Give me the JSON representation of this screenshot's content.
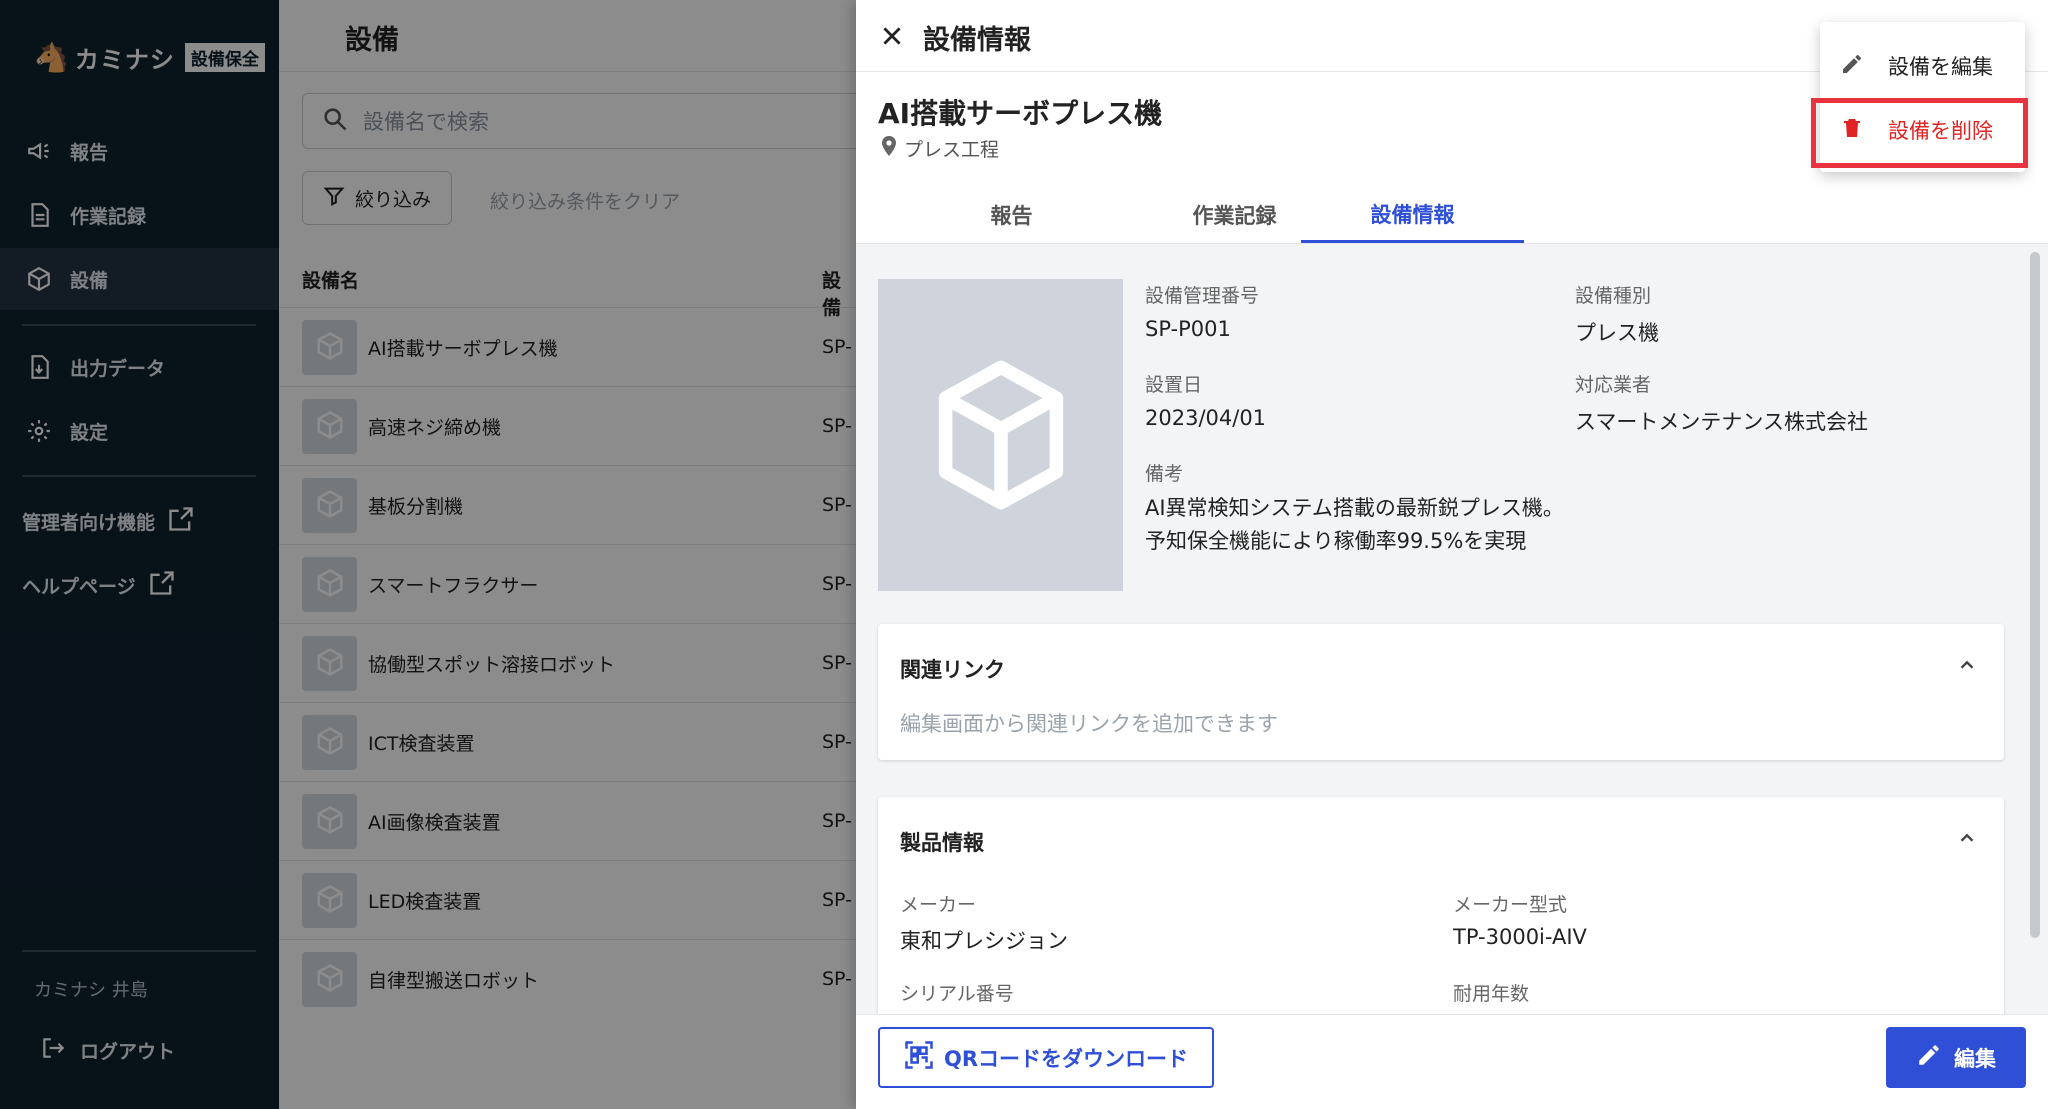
{
  "sidebar": {
    "logo_text": "カミナシ",
    "logo_badge": "設備保全",
    "items": [
      {
        "label": "報告",
        "icon": "megaphone-icon"
      },
      {
        "label": "作業記録",
        "icon": "document-icon"
      },
      {
        "label": "設備",
        "icon": "cube-icon"
      },
      {
        "label": "出力データ",
        "icon": "file-export-icon"
      },
      {
        "label": "設定",
        "icon": "gear-icon"
      }
    ],
    "external": [
      {
        "label": "管理者向け機能",
        "icon": "external-link-icon"
      },
      {
        "label": "ヘルプページ",
        "icon": "external-link-icon"
      }
    ],
    "user_name": "カミナシ 井島",
    "logout_label": "ログアウト"
  },
  "main": {
    "title": "設備",
    "search_placeholder": "設備名で検索",
    "filter_label": "絞り込み",
    "clear_filter_label": "絞り込み条件をクリア",
    "columns": [
      "設備名",
      "設備"
    ],
    "rows": [
      {
        "name": "AI搭載サーボプレス機",
        "code": "SP-"
      },
      {
        "name": "高速ネジ締め機",
        "code": "SP-"
      },
      {
        "name": "基板分割機",
        "code": "SP-"
      },
      {
        "name": "スマートフラクサー",
        "code": "SP-"
      },
      {
        "name": "協働型スポット溶接ロボット",
        "code": "SP-"
      },
      {
        "name": "ICT検査装置",
        "code": "SP-"
      },
      {
        "name": "AI画像検査装置",
        "code": "SP-"
      },
      {
        "name": "LED検査装置",
        "code": "SP-"
      },
      {
        "name": "自律型搬送ロボット",
        "code": "SP-"
      }
    ]
  },
  "drawer": {
    "title": "設備情報",
    "equipment_name": "AI搭載サーボプレス機",
    "location": "プレス工程",
    "tabs": [
      {
        "label": "報告",
        "active": false
      },
      {
        "label": "作業記録",
        "active": false
      },
      {
        "label": "設備情報",
        "active": true
      }
    ],
    "fields": {
      "id_label": "設備管理番号",
      "id_value": "SP-P001",
      "type_label": "設備種別",
      "type_value": "プレス機",
      "install_label": "設置日",
      "install_value": "2023/04/01",
      "vendor_label": "対応業者",
      "vendor_value": "スマートメンテナンス株式会社",
      "note_label": "備考",
      "note_value": "AI異常検知システム搭載の最新鋭プレス機。予知保全機能により稼働率99.5%を実現"
    },
    "links_card": {
      "title": "関連リンク",
      "hint": "編集画面から関連リンクを追加できます"
    },
    "product_card": {
      "title": "製品情報",
      "maker_label": "メーカー",
      "maker_value": "東和プレシジョン",
      "model_label": "メーカー型式",
      "model_value": "TP-3000i-AIV",
      "serial_label": "シリアル番号",
      "life_label": "耐用年数"
    },
    "qr_button_label": "QRコードをダウンロード",
    "edit_button_label": "編集"
  },
  "menu": {
    "edit_label": "設備を編集",
    "delete_label": "設備を削除"
  },
  "colors": {
    "sidebar_bg": "#10212f",
    "accent": "#2e4fd6",
    "danger": "#e02424",
    "highlight": "#e8343e"
  }
}
